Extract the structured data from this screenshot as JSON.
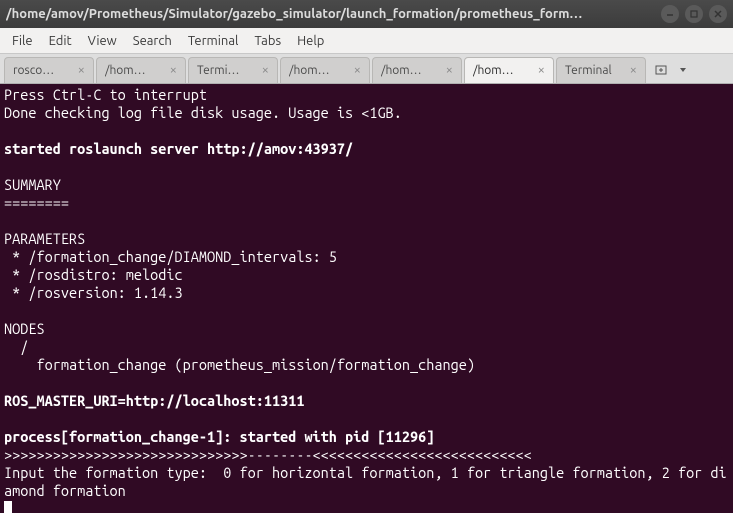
{
  "titlebar": {
    "path": "/home/amov/Prometheus/Simulator/gazebo_simulator/launch_formation/prometheus_form…"
  },
  "menubar": {
    "file": "File",
    "edit": "Edit",
    "view": "View",
    "search": "Search",
    "terminal": "Terminal",
    "tabs": "Tabs",
    "help": "Help"
  },
  "tabs": [
    {
      "label": "rosco…"
    },
    {
      "label": "/hom…"
    },
    {
      "label": "Termi…"
    },
    {
      "label": "/hom…"
    },
    {
      "label": "/hom…"
    },
    {
      "label": "/hom…"
    },
    {
      "label": "Terminal"
    }
  ],
  "term": {
    "l0": "Press Ctrl-C to interrupt",
    "l1": "Done checking log file disk usage. Usage is <1GB.",
    "l2": "",
    "l3": "started roslaunch server http://amov:43937/",
    "l4": "",
    "l5": "SUMMARY",
    "l6": "========",
    "l7": "",
    "l8": "PARAMETERS",
    "l9": " * /formation_change/DIAMOND_intervals: 5",
    "l10": " * /rosdistro: melodic",
    "l11": " * /rosversion: 1.14.3",
    "l12": "",
    "l13": "NODES",
    "l14": "  /",
    "l15": "    formation_change (prometheus_mission/formation_change)",
    "l16": "",
    "l17": "ROS_MASTER_URI=http://localhost:11311",
    "l18": "",
    "l19": "process[formation_change-1]: started with pid [11296]",
    "l20": ">>>>>>>>>>>>>>>>>>>>>>>>>>>>>>--------<<<<<<<<<<<<<<<<<<<<<<<<<<<",
    "l21": "Input the formation type:  0 for horizontal formation, 1 for triangle formation, 2 for diamond formation"
  }
}
